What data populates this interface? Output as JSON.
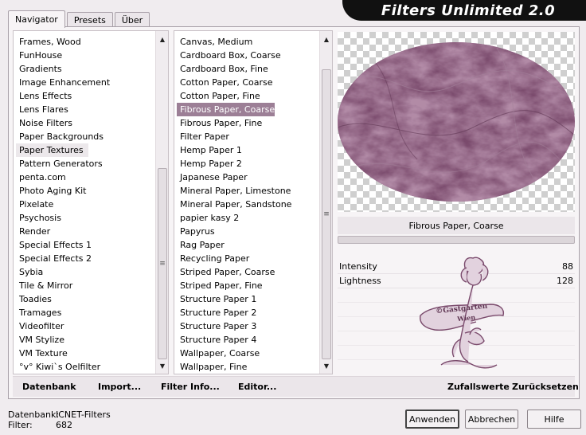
{
  "app": {
    "title": "Filters Unlimited 2.0"
  },
  "tabs": [
    {
      "label": "Navigator",
      "active": true
    },
    {
      "label": "Presets",
      "active": false
    },
    {
      "label": "Über",
      "active": false
    }
  ],
  "categories": {
    "items": [
      "Frames, Wood",
      "FunHouse",
      "Gradients",
      "Image Enhancement",
      "Lens Effects",
      "Lens Flares",
      "Noise Filters",
      "Paper Backgrounds",
      "Paper Textures",
      "Pattern Generators",
      "penta.com",
      "Photo Aging Kit",
      "Pixelate",
      "Psychosis",
      "Render",
      "Special Effects 1",
      "Special Effects 2",
      "Sybia",
      "Tile & Mirror",
      "Toadies",
      "Tramages",
      "Videofilter",
      "VM Stylize",
      "VM Texture",
      "°v° Kiwi`s Oelfilter"
    ],
    "selected": "Paper Textures"
  },
  "filters": {
    "items": [
      "Canvas, Medium",
      "Cardboard Box, Coarse",
      "Cardboard Box, Fine",
      "Cotton Paper, Coarse",
      "Cotton Paper, Fine",
      "Fibrous Paper, Coarse",
      "Fibrous Paper, Fine",
      "Filter Paper",
      "Hemp Paper 1",
      "Hemp Paper 2",
      "Japanese Paper",
      "Mineral Paper, Limestone",
      "Mineral Paper, Sandstone",
      "papier kasy 2",
      "Papyrus",
      "Rag Paper",
      "Recycling Paper",
      "Striped Paper, Coarse",
      "Striped Paper, Fine",
      "Structure Paper 1",
      "Structure Paper 2",
      "Structure Paper 3",
      "Structure Paper 4",
      "Wallpaper, Coarse",
      "Wallpaper, Fine"
    ],
    "selected": "Fibrous Paper, Coarse"
  },
  "preview": {
    "filter_name": "Fibrous Paper, Coarse",
    "texture_color": "#7a4a6c"
  },
  "params": [
    {
      "label": "Intensity",
      "value": "88"
    },
    {
      "label": "Lightness",
      "value": "128"
    }
  ],
  "watermark": {
    "text_line1": "©Gastgarten",
    "text_line2": "Wien"
  },
  "toolbar": {
    "datenbank": "Datenbank",
    "import": "Import...",
    "filter_info": "Filter Info...",
    "editor": "Editor...",
    "zufallswerte": "Zufallswerte",
    "zuruecksetzen": "Zurücksetzen"
  },
  "status": {
    "db_label": "Datenbank:",
    "db_value": "ICNET-Filters",
    "filter_label": "Filter:",
    "filter_value": "682"
  },
  "buttons": {
    "apply": "Anwenden",
    "cancel": "Abbrechen",
    "help": "Hilfe"
  },
  "colors": {
    "selection": "#9c7f96",
    "banner": "#111111"
  }
}
